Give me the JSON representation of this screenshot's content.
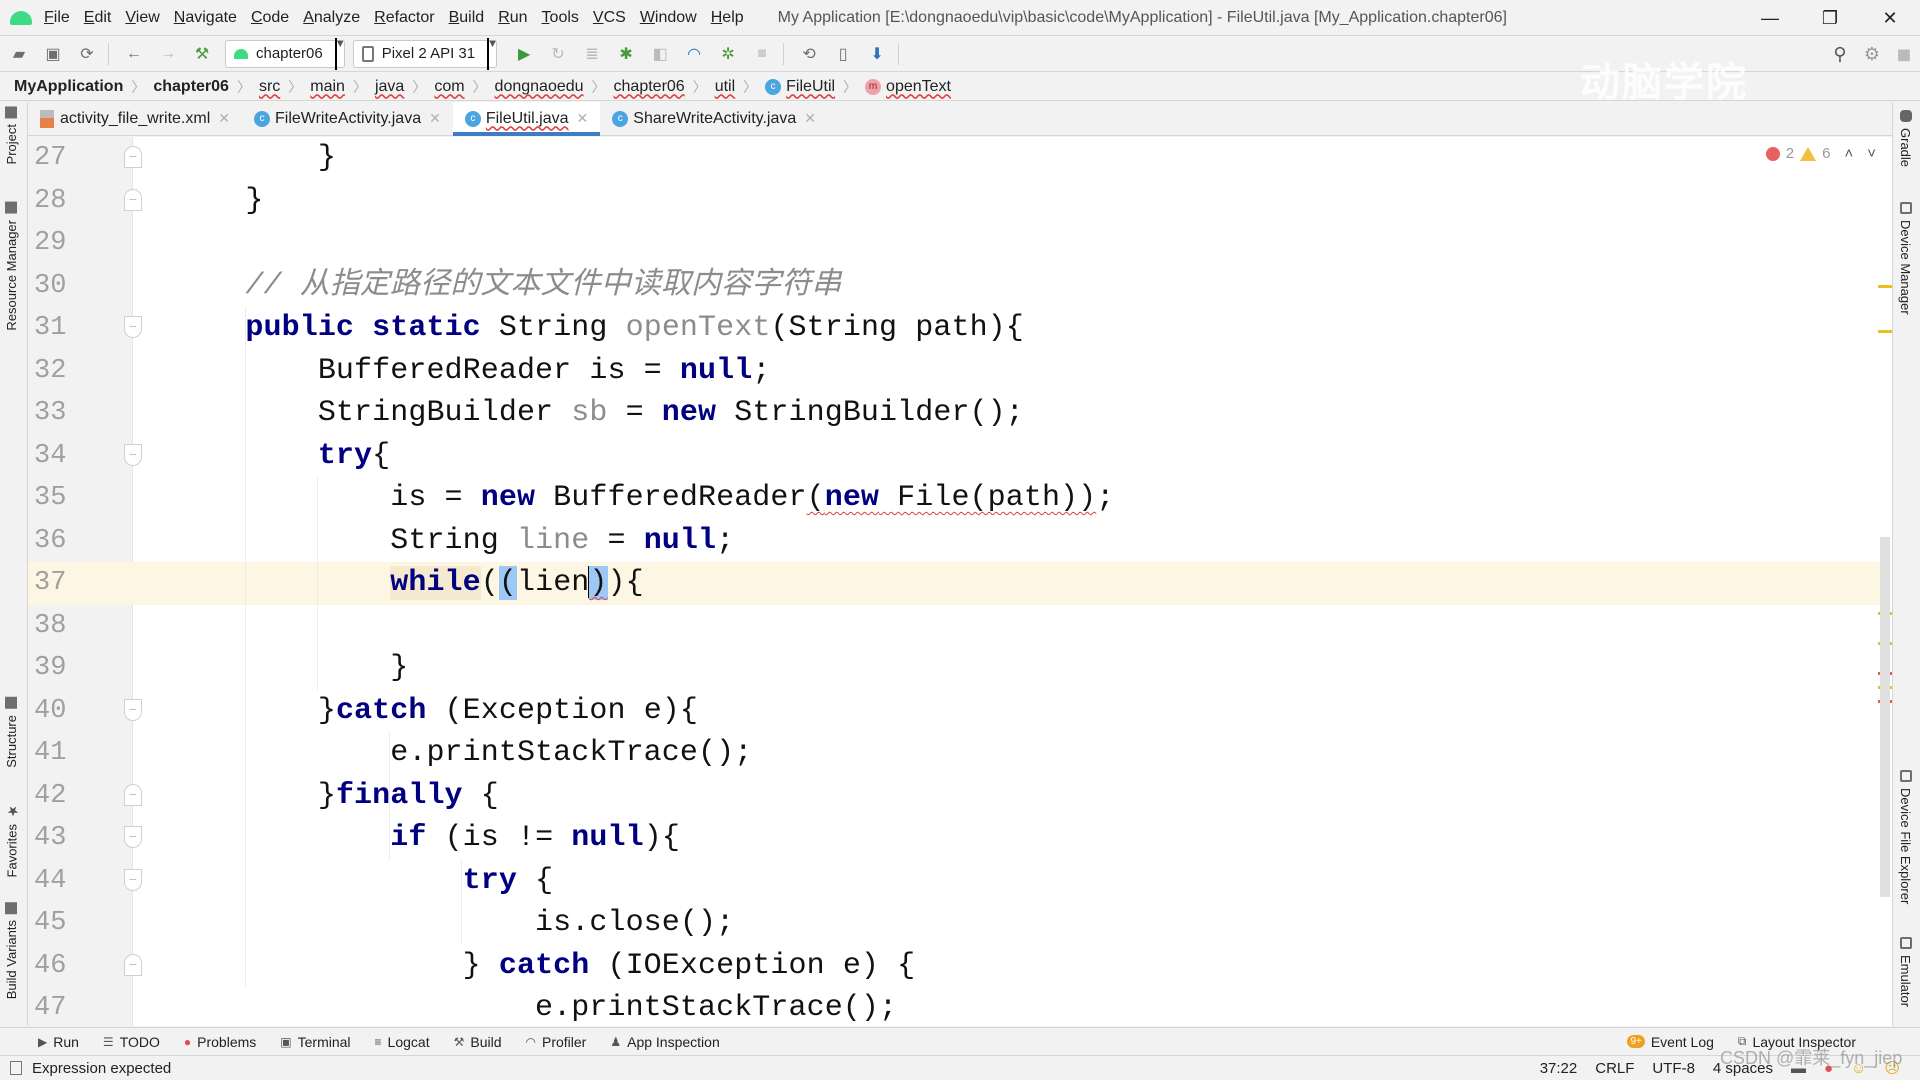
{
  "titlebar": {
    "menu": [
      "File",
      "Edit",
      "View",
      "Navigate",
      "Code",
      "Analyze",
      "Refactor",
      "Build",
      "Run",
      "Tools",
      "VCS",
      "Window",
      "Help"
    ],
    "window_title": "My Application [E:\\dongnaoedu\\vip\\basic\\code\\MyApplication] - FileUtil.java [My_Application.chapter06]",
    "controls": {
      "minimize": "—",
      "restore": "❐",
      "close": "✕"
    }
  },
  "toolbar": {
    "module_combo": "chapter06",
    "device_combo": "Pixel 2 API 31",
    "watermark": "动脑学院"
  },
  "breadcrumb": [
    {
      "label": "MyApplication",
      "bold": true
    },
    {
      "label": "chapter06",
      "bold": true
    },
    {
      "label": "src"
    },
    {
      "label": "main"
    },
    {
      "label": "java"
    },
    {
      "label": "com"
    },
    {
      "label": "dongnaoedu"
    },
    {
      "label": "chapter06"
    },
    {
      "label": "util"
    },
    {
      "label": "FileUtil",
      "icon": "class-icon"
    },
    {
      "label": "openText",
      "icon": "method-icon"
    }
  ],
  "left_stripe": {
    "project": "Project",
    "resource_manager": "Resource Manager",
    "structure": "Structure",
    "favorites": "Favorites",
    "build_variants": "Build Variants"
  },
  "right_stripe": {
    "gradle": "Gradle",
    "device_manager": "Device Manager",
    "device_file_explorer": "Device File Explorer",
    "emulator": "Emulator"
  },
  "tabs": [
    {
      "label": "activity_file_write.xml",
      "type": "xml"
    },
    {
      "label": "FileWriteActivity.java",
      "type": "class"
    },
    {
      "label": "FileUtil.java",
      "type": "class",
      "active": true
    },
    {
      "label": "ShareWriteActivity.java",
      "type": "class"
    }
  ],
  "inspections": {
    "errors": "2",
    "warnings": "6"
  },
  "editor": {
    "current_line": 37,
    "lines": [
      {
        "n": "27",
        "text": "        }"
      },
      {
        "n": "28",
        "text": "    }"
      },
      {
        "n": "29",
        "text": ""
      },
      {
        "n": "30",
        "text": "    // 从指定路径的文本文件中读取内容字符串"
      },
      {
        "n": "31",
        "text": "    public static String openText(String path){"
      },
      {
        "n": "32",
        "text": "        BufferedReader is = null;"
      },
      {
        "n": "33",
        "text": "        StringBuilder sb = new StringBuilder();"
      },
      {
        "n": "34",
        "text": "        try{"
      },
      {
        "n": "35",
        "text": "            is = new BufferedReader(new File(path));"
      },
      {
        "n": "36",
        "text": "            String line = null;"
      },
      {
        "n": "37",
        "text": "            while((lien)){"
      },
      {
        "n": "38",
        "text": ""
      },
      {
        "n": "39",
        "text": "            }"
      },
      {
        "n": "40",
        "text": "        }catch (Exception e){"
      },
      {
        "n": "41",
        "text": "            e.printStackTrace();"
      },
      {
        "n": "42",
        "text": "        }finally {"
      },
      {
        "n": "43",
        "text": "            if (is != null){"
      },
      {
        "n": "44",
        "text": "                try {"
      },
      {
        "n": "45",
        "text": "                    is.close();"
      },
      {
        "n": "46",
        "text": "                } catch (IOException e) {"
      },
      {
        "n": "47",
        "text": "                    e.printStackTrace();"
      }
    ]
  },
  "tool_windows": [
    "Run",
    "TODO",
    "Problems",
    "Terminal",
    "Logcat",
    "Build",
    "Profiler",
    "App Inspection"
  ],
  "tool_windows_right": {
    "event_log": "Event Log",
    "event_badge": "9+",
    "layout_inspector": "Layout Inspector"
  },
  "statusbar": {
    "message": "Expression expected",
    "position": "37:22",
    "line_sep": "CRLF",
    "encoding": "UTF-8",
    "indent": "4 spaces"
  },
  "overlay": {
    "csdn": "CSDN @霏莱_fyn_jiep"
  }
}
